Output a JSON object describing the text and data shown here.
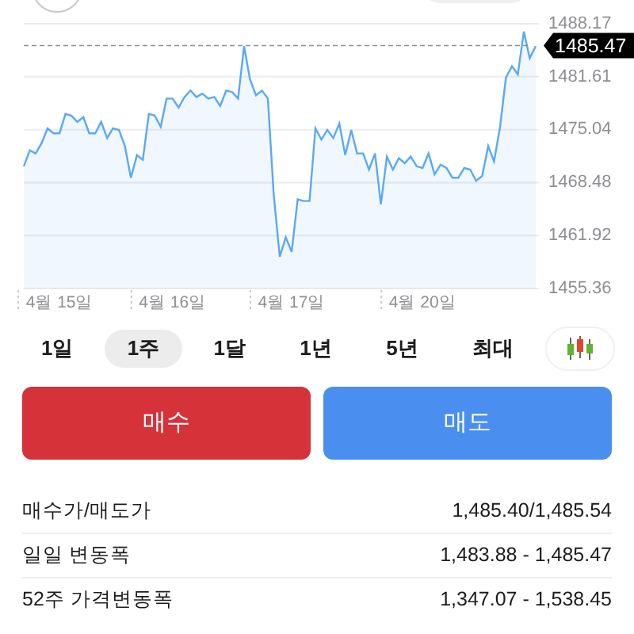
{
  "chart": {
    "chart_data": {
      "type": "area",
      "categories": [
        null,
        null,
        null,
        null,
        null,
        null,
        "4월 15일",
        null,
        null,
        null,
        null,
        null,
        null,
        null,
        null,
        null,
        null,
        null,
        null,
        null,
        null,
        null,
        null,
        null,
        null,
        "4월 16일",
        null,
        null,
        null,
        null,
        null,
        null,
        null,
        null,
        null,
        null,
        null,
        null,
        null,
        null,
        null,
        null,
        null,
        null,
        null,
        "4월 17일",
        null,
        null,
        null,
        null,
        null,
        null,
        null,
        null,
        null,
        null,
        null,
        null,
        null,
        null,
        null,
        null,
        null,
        null,
        null,
        null,
        null,
        "4월 20일",
        null,
        null,
        null,
        null,
        null,
        null,
        null,
        null,
        null,
        null,
        null,
        null,
        null,
        null,
        null,
        null,
        null,
        null,
        null
      ],
      "series": [
        {
          "color": "#5aa9f5",
          "values": [
            1470.5,
            1472.5,
            1472.1,
            1473.4,
            1475.2,
            1474.6,
            1474.6,
            1477.0,
            1476.8,
            1476.0,
            1476.6,
            1474.6,
            1474.6,
            1476.0,
            1474.0,
            1475.2,
            1475.0,
            1473.0,
            1469.1,
            1471.9,
            1471.3,
            1477.0,
            1476.8,
            1475.4,
            1478.9,
            1478.9,
            1477.8,
            1479.1,
            1479.9,
            1479.1,
            1479.5,
            1478.9,
            1479.1,
            1478.0,
            1479.9,
            1479.7,
            1478.9,
            1485.4,
            1481.3,
            1479.3,
            1479.9,
            1478.9,
            1467.0,
            1459.3,
            1461.7,
            1459.9,
            1466.4,
            1466.2,
            1466.2,
            1475.2,
            1473.8,
            1475.0,
            1474.0,
            1475.8,
            1471.9,
            1475.0,
            1472.1,
            1472.1,
            1470.1,
            1472.1,
            1465.8,
            1471.7,
            1470.1,
            1471.5,
            1470.9,
            1471.7,
            1470.5,
            1470.3,
            1472.1,
            1469.5,
            1470.7,
            1470.3,
            1469.1,
            1469.1,
            1470.3,
            1470.1,
            1468.7,
            1469.3,
            1473.0,
            1471.1,
            1475.4,
            1481.5,
            1482.9,
            1481.9,
            1487.2,
            1483.9,
            1485.4
          ]
        }
      ],
      "ylim": [
        1455.36,
        1488.17
      ],
      "grid": true,
      "yticks": [
        1488.17,
        1481.61,
        1475.04,
        1468.48,
        1461.92,
        1455.36
      ],
      "ref_lines": [
        {
          "axis": "y",
          "value": 1485.47,
          "label": "1485.47"
        }
      ]
    }
  },
  "ranges": [
    {
      "label": "1일",
      "selected": false
    },
    {
      "label": "1주",
      "selected": true
    },
    {
      "label": "1달",
      "selected": false
    },
    {
      "label": "1년",
      "selected": false
    },
    {
      "label": "5년",
      "selected": false
    },
    {
      "label": "최대",
      "selected": false
    }
  ],
  "actions": [
    {
      "kind": "buy",
      "label": "매수"
    },
    {
      "kind": "sell",
      "label": "매도"
    }
  ],
  "stats": [
    {
      "label": "매수가/매도가",
      "value": "1,485.40/1,485.54"
    },
    {
      "label": "일일 변동폭",
      "value": "1,483.88 - 1,485.47"
    },
    {
      "label": "52주 가격변동폭",
      "value": "1,347.07 - 1,538.45"
    }
  ]
}
